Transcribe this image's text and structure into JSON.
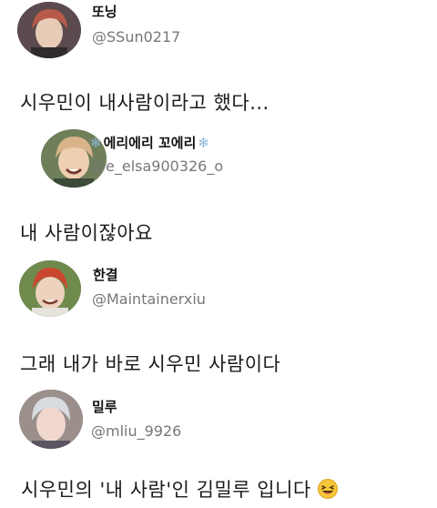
{
  "posts": [
    {
      "name": "또닝",
      "handle": "@SSun0217",
      "text": "시우민이 내사람이라고 했다...",
      "avatar_colors": {
        "bg": "#5b4a4e",
        "hair": "#b85a4a",
        "skin": "#e8cbb6"
      }
    },
    {
      "name": "에리에리 꼬에리",
      "name_prefix": "❄",
      "name_suffix": "❄",
      "handle": "@e_elsa900326_o",
      "text": "내 사람이잖아요",
      "avatar_colors": {
        "bg": "#6e7f5a",
        "hair": "#d9b48a",
        "skin": "#efcfb2"
      }
    },
    {
      "name": "한결",
      "handle": "@Maintainerxiu",
      "text": "그래 내가 바로 시우민 사람이다",
      "avatar_colors": {
        "bg": "#6f8a4c",
        "hair": "#c9472e",
        "skin": "#efd2be"
      }
    },
    {
      "name": "밀루",
      "handle": "@mliu_9926",
      "text": "시우민의 '내 사람'인 김밀루 입니다",
      "text_emoji": "laughing-emoji",
      "avatar_colors": {
        "bg": "#9a8f8a",
        "hair": "#d8dbe0",
        "skin": "#f1d8cf"
      }
    }
  ]
}
